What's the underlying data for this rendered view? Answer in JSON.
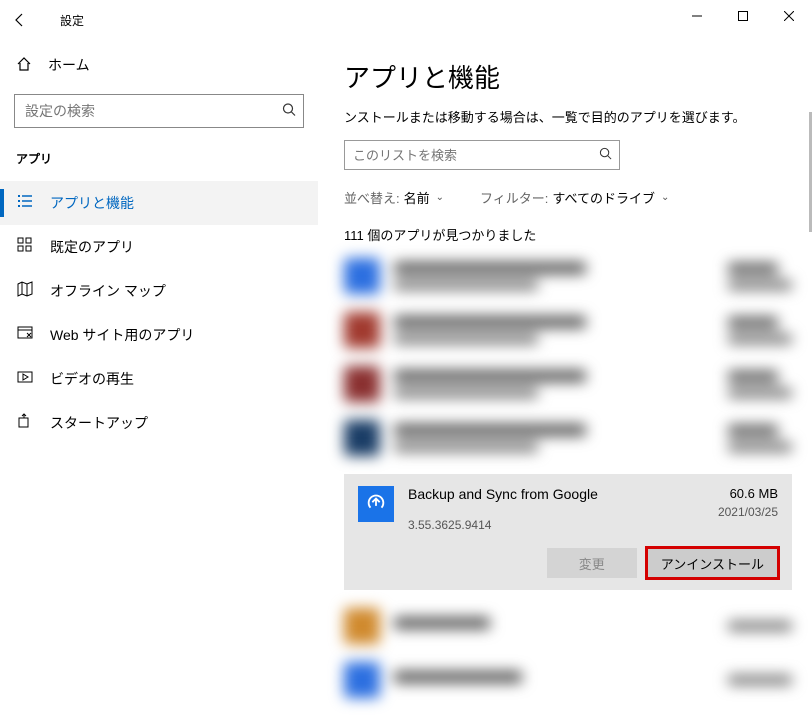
{
  "titlebar": {
    "title": "設定"
  },
  "sidebar": {
    "home_label": "ホーム",
    "search_placeholder": "設定の検索",
    "category_label": "アプリ",
    "items": [
      {
        "label": "アプリと機能"
      },
      {
        "label": "既定のアプリ"
      },
      {
        "label": "オフライン マップ"
      },
      {
        "label": "Web サイト用のアプリ"
      },
      {
        "label": "ビデオの再生"
      },
      {
        "label": "スタートアップ"
      }
    ]
  },
  "main": {
    "title": "アプリと機能",
    "subtitle": "ンストールまたは移動する場合は、一覧で目的のアプリを選びます。",
    "list_search_placeholder": "このリストを検索",
    "sort_label": "並べ替え:",
    "sort_value": "名前",
    "filter_label": "フィルター:",
    "filter_value": "すべてのドライブ",
    "count_text": "111 個のアプリが見つかりました",
    "selected": {
      "name": "Backup and Sync from Google",
      "version": "3.55.3625.9414",
      "size": "60.6 MB",
      "date": "2021/03/25",
      "modify_label": "変更",
      "uninstall_label": "アンインストール"
    }
  }
}
